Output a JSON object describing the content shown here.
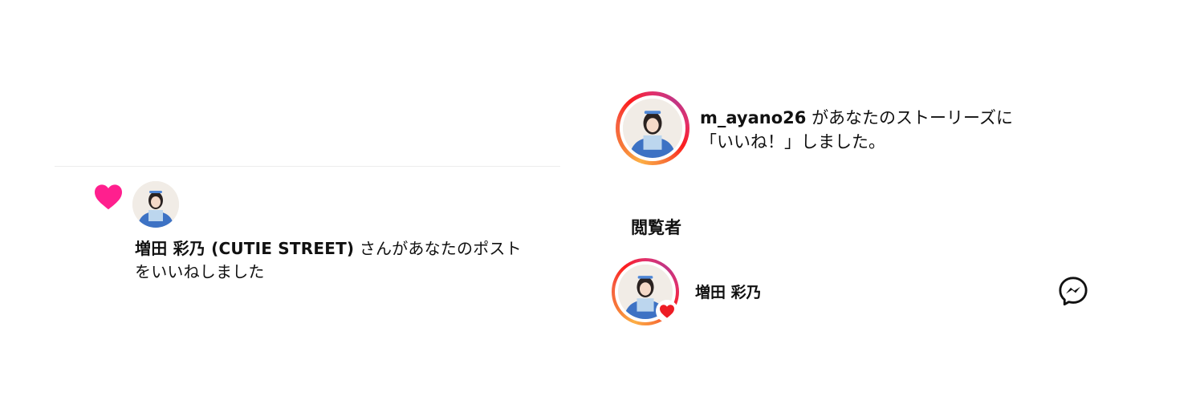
{
  "left_notification": {
    "user_display": "増田 彩乃 (CUTIE STREET)",
    "message_line1": "さんがあなたのポスト",
    "message_line2": "をいいねしました",
    "colors": {
      "heart": "#ff1f8e"
    },
    "icons": [
      "heart-icon",
      "avatar"
    ]
  },
  "story_like": {
    "username": "m_ayano26",
    "message_line1": "があなたのストーリーズに",
    "message_line2": "「いいね！」しました。"
  },
  "viewers": {
    "title": "閲覧者",
    "items": [
      {
        "name": "増田 彩乃",
        "liked": true
      }
    ]
  },
  "colors": {
    "ring_gradient": [
      "#fcaf45",
      "#fd1d1d",
      "#e1306c",
      "#c13584"
    ],
    "like_red": "#ed1c24"
  }
}
